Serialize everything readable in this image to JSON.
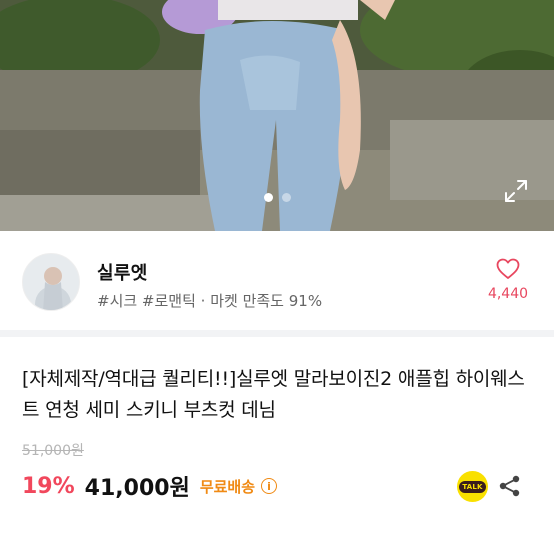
{
  "hero": {
    "image_desc_icon": "product-photo",
    "page_indicator": {
      "count": 2,
      "active": 0
    },
    "expand_icon": "expand-icon"
  },
  "shop": {
    "name": "실루엣",
    "tags": "#시크 #로맨틱 · 마켓 만족도 91%",
    "like_count": "4,440",
    "avatar_icon": "avatar"
  },
  "product": {
    "title": "[자체제작/역대급 퀄리티!!]실루엣 말라보이진2 애플힙 하이웨스트 연청 세미 스키니 부츠컷 데님",
    "original_price": "51,000원",
    "discount": "19%",
    "price": "41,000원",
    "shipping": "무료배송",
    "info_icon_glyph": "i",
    "talk_label": "TALK"
  },
  "colors": {
    "discount": "#f1475c",
    "shipping": "#f08a14",
    "heart": "#e8475f",
    "talk_bg": "#f9e000"
  }
}
